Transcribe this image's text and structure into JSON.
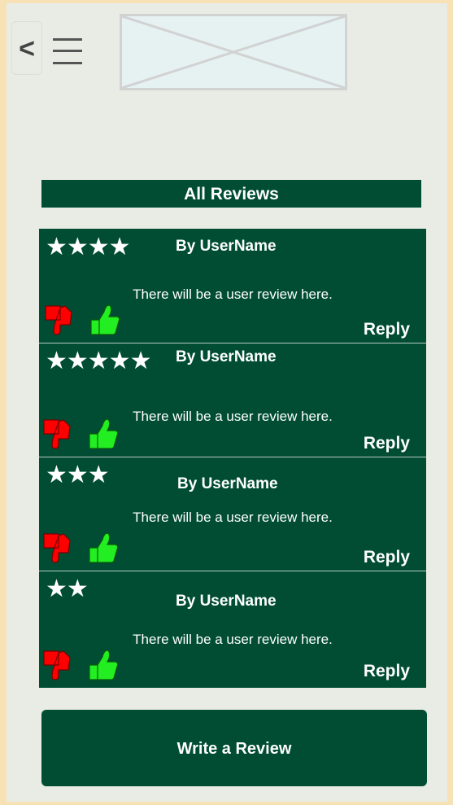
{
  "header": {
    "back_label": "<",
    "icons": {
      "back": "back-chevron-icon",
      "menu": "hamburger-menu-icon",
      "logo": "image-placeholder"
    }
  },
  "reviews_section": {
    "title": "All Reviews",
    "reviews": [
      {
        "stars": "★★★★",
        "rating": 4,
        "author": "By UserName",
        "text": "There will be a user review here.",
        "reply_label": "Reply"
      },
      {
        "stars": "★★★★★",
        "rating": 5,
        "author": "By UserName",
        "text": "There will be a user review here.",
        "reply_label": "Reply"
      },
      {
        "stars": "★★★",
        "rating": 3,
        "author": "By UserName",
        "text": "There will be a user review here.",
        "reply_label": "Reply"
      },
      {
        "stars": "★★",
        "rating": 2,
        "author": "By UserName",
        "text": "There will be a user review here.",
        "reply_label": "Reply"
      }
    ]
  },
  "write_review_label": "Write a Review",
  "colors": {
    "primary": "#004d34",
    "thumb_down": "#ff0000",
    "thumb_up": "#22ee22",
    "background": "#e9ece4",
    "page_border": "#f6e2b4"
  }
}
